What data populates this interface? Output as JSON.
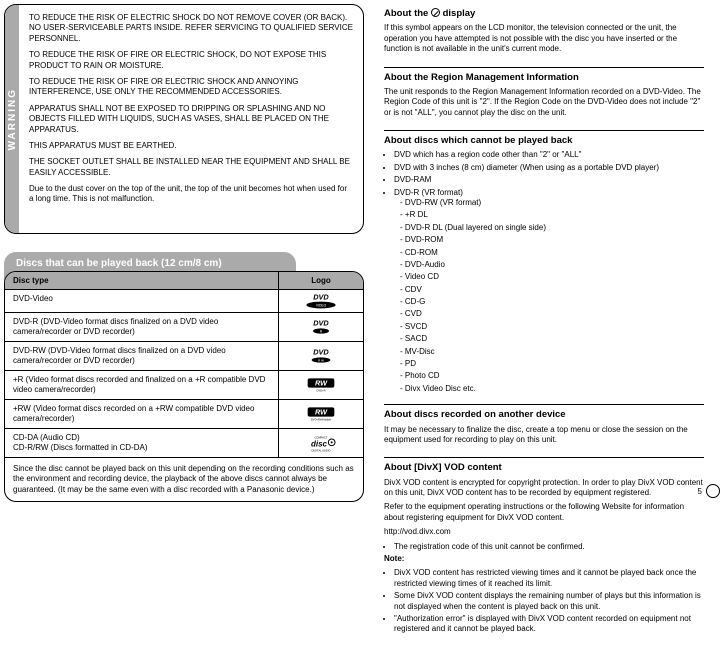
{
  "warning": {
    "stripe": "WARNING",
    "paragraphs": [
      "TO REDUCE THE RISK OF ELECTRIC SHOCK DO NOT REMOVE COVER (OR BACK). NO USER-SERVICEABLE PARTS INSIDE. REFER SERVICING TO QUALIFIED SERVICE PERSONNEL.",
      "TO REDUCE THE RISK OF FIRE OR ELECTRIC SHOCK, DO NOT EXPOSE THIS PRODUCT TO RAIN OR MOISTURE.",
      "TO REDUCE THE RISK OF FIRE OR ELECTRIC SHOCK AND ANNOYING INTERFERENCE, USE ONLY THE RECOMMENDED ACCESSORIES.",
      "APPARATUS SHALL NOT BE EXPOSED TO DRIPPING OR SPLASHING AND NO OBJECTS FILLED WITH LIQUIDS, SUCH AS VASES, SHALL BE PLACED ON THE APPARATUS.",
      "THIS APPARATUS MUST BE EARTHED.",
      "THE SOCKET OUTLET SHALL BE INSTALLED NEAR THE EQUIPMENT AND SHALL BE EASILY ACCESSIBLE.",
      "Due to the dust cover on the top of the unit, the top of the unit becomes hot when used for a long time. This is not malfunction."
    ]
  },
  "discs": {
    "title": "Discs that can be played back (12 cm/8 cm)",
    "head": {
      "c1": "Disc type",
      "c2": "Logo"
    },
    "rows": [
      {
        "c1": "DVD-Video",
        "kind": "dvd"
      },
      {
        "c1": "DVD-R (DVD-Video format discs finalized on a DVD video camera/recorder or DVD recorder)",
        "kind": "dvd-r"
      },
      {
        "c1": "DVD-RW (DVD-Video format discs finalized on a DVD video camera/recorder or DVD recorder)",
        "kind": "dvd-rw"
      },
      {
        "c1": "+R (Video format discs recorded and finalized on a +R compatible DVD video camera/recorder)",
        "kind": "plusr"
      },
      {
        "c1": "+RW (Video format discs recorded on a +RW compatible DVD video camera/recorder)",
        "kind": "plusrw"
      },
      {
        "c1": "CD-DA (Audio CD)\nCD-R/RW (Discs formatted in CD-DA)",
        "kind": "cd"
      }
    ],
    "footer": "Since the disc cannot be played back on this unit depending on the recording conditions such as the environment and recording device, the playback of the above discs cannot always be guaranteed. (It may be the same even with a disc recorded with a Panasonic device.)"
  },
  "right": {
    "sec1": {
      "title_pre": "About the ",
      "title_post": " display",
      "body": "If this symbol appears on the LCD monitor, the television connected or the unit, the operation you have attempted is not possible with the disc you have inserted or the function is not available in the unit's current mode."
    },
    "sec2": {
      "title": "About the Region Management Information",
      "body": "The unit responds to the Region Management Information recorded on a DVD-Video. The Region Code of this unit is \"2\". If the Region Code on the DVD-Video does not include \"2\" or is not \"ALL\", you cannot play the disc on the unit."
    },
    "sec3": {
      "title": "About discs which cannot be played back",
      "bullets": [
        "DVD which has a region code other than \"2\" or \"ALL\"",
        "DVD with 3 inches (8 cm) diameter (When using as a portable DVD player)",
        "DVD-RAM",
        "DVD-R (VR format)",
        "DVD-RW (VR format)",
        "+R DL",
        "DVD-R DL (Dual layered on single side)",
        "DVD-ROM",
        "CD-ROM",
        "DVD-Audio",
        "Video CD",
        "CDV",
        "CD-G",
        "CVD",
        "SVCD",
        "SACD",
        "MV-Disc",
        "PD",
        "Photo CD",
        "Divx Video Disc etc."
      ]
    },
    "sec4": {
      "title": "About discs recorded on another device",
      "body": "It may be necessary to finalize the disc, create a top menu or close the session on the equipment used for recording to play on this unit."
    },
    "sec5": {
      "title": "About [DivX] VOD content",
      "lines": [
        "DivX VOD content is encrypted for copyright protection. In order to play DivX VOD content on this unit, DivX VOD content has to be recorded by equipment registered.",
        "Refer to the equipment operating instructions or the following Website for information about registering equipment for DivX VOD content.",
        "http://vod.divx.com",
        "The registration code of this unit cannot be confirmed."
      ],
      "note_label": "Note:",
      "notes": [
        "DivX VOD content has restricted viewing times and it cannot be played back once the restricted viewing times of it reached its limit.",
        "Some DivX VOD content displays the remaining number of plays but this information is not displayed when the content is played back on this unit.",
        "\"Authorization error\" is displayed with DivX VOD content recorded on equipment not registered and it cannot be played back."
      ]
    }
  },
  "page_num": "5"
}
